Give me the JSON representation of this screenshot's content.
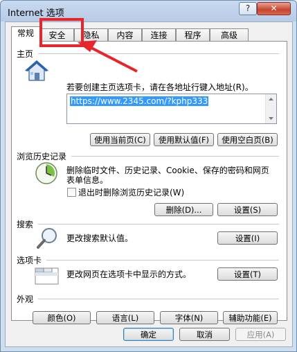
{
  "window": {
    "title": "Internet 选项",
    "help": "?",
    "close": "✕"
  },
  "tabs": [
    "常规",
    "安全",
    "隐私",
    "内容",
    "连接",
    "程序",
    "高级"
  ],
  "home": {
    "section": "主页",
    "desc": "若要创建主页选项卡，请在各地址行键入地址(R)。",
    "url": "https://www.2345.com/?kphp333",
    "buttons": [
      "使用当前页(C)",
      "使用默认值(F)",
      "使用空白页(B)"
    ]
  },
  "history": {
    "section": "浏览历史记录",
    "desc_line1": "删除临时文件、历史记录、Cookie、保存的密码和网页",
    "desc_line2": "表单信息。",
    "checkbox_label": "退出时删除浏览历史记录(W)",
    "delete_button": "删除(D)...",
    "settings_button": "设置(S)"
  },
  "search": {
    "section": "搜索",
    "desc": "更改搜索默认值。",
    "settings_button": "设置(I)"
  },
  "tabs_section": {
    "section": "选项卡",
    "desc": "更改网页在选项卡中显示的方式。",
    "settings_button": "设置(T)"
  },
  "appearance": {
    "section": "外观",
    "buttons": [
      "颜色(O)",
      "语言(L)",
      "字体(N)",
      "辅助功能(E)"
    ]
  },
  "footer": {
    "ok": "确定",
    "cancel": "取消",
    "apply": "应用(A)"
  },
  "colors": {
    "highlight": "#e8252a",
    "selection": "#3399ff"
  }
}
